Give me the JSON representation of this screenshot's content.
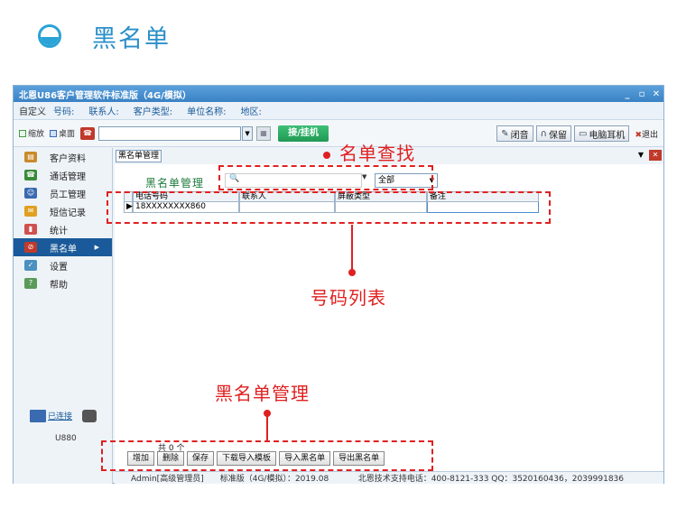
{
  "heading": {
    "title": "黑名单"
  },
  "window": {
    "title": "北恩U86客户管理软件标准版（4G/模拟）",
    "min": "_",
    "max": "▫",
    "close": "✕"
  },
  "infobar": {
    "custom": "自定义",
    "fields": [
      "号码:",
      "联系人:",
      "客户类型:",
      "单位名称:",
      "地区:"
    ]
  },
  "toolbar": {
    "collapse": "缩放",
    "desktop": "桌面",
    "answer": "接/挂机",
    "mute": "闭音",
    "hold": "保留",
    "headset": "电脑耳机",
    "exit": "退出"
  },
  "sidebar": {
    "items": [
      {
        "label": "客户资料",
        "color": "#c98a2a"
      },
      {
        "label": "通话管理",
        "color": "#3a8a3a"
      },
      {
        "label": "员工管理",
        "color": "#3a6ab0"
      },
      {
        "label": "短信记录",
        "color": "#e0a020"
      },
      {
        "label": "统计",
        "color": "#d05050"
      },
      {
        "label": "黑名单",
        "color": "#c0392b"
      },
      {
        "label": "设置",
        "color": "#4a90c0"
      },
      {
        "label": "帮助",
        "color": "#5a9a5a"
      }
    ],
    "connection": "已连接",
    "model": "U880"
  },
  "content": {
    "tab": "黑名单管理",
    "mgmt_label": "黑名单管理",
    "search_placeholder": "🔍",
    "type_selected": "全部",
    "columns": [
      "电话号码",
      "联系人",
      "屏蔽类型",
      "备注"
    ],
    "rows": [
      [
        "18XXXXXXXX860",
        "",
        "",
        ""
      ]
    ],
    "count": "共 0 个",
    "actions": [
      "增加",
      "删除",
      "保存",
      "下载导入模板",
      "导入黑名单",
      "导出黑名单"
    ]
  },
  "statusbar": {
    "user": "Admin[高级管理员]",
    "version": "标准版（4G/模拟）：2019.08",
    "support": "北恩技术支持电话：400-8121-333  QQ：3520160436，2039991836"
  },
  "annotations": {
    "search": "名单查找",
    "list": "号码列表",
    "manage": "黑名单管理"
  }
}
